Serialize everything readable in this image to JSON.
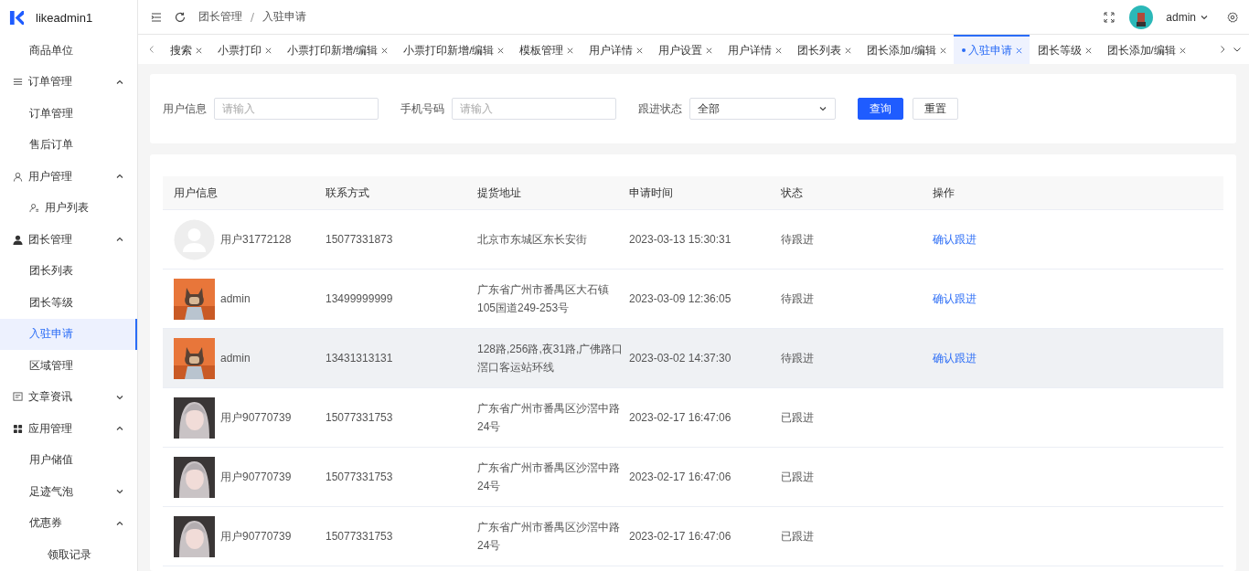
{
  "app": {
    "name": "likeadmin1"
  },
  "sidebar": {
    "items": [
      {
        "label": "商品单位",
        "selected": false
      },
      {
        "label": "订单管理",
        "expanded": true,
        "children": [
          {
            "label": "订单管理",
            "selected": false
          },
          {
            "label": "售后订单",
            "selected": false
          }
        ]
      },
      {
        "label": "用户管理",
        "expanded": true,
        "children": [
          {
            "label": "用户列表",
            "selected": false
          }
        ]
      },
      {
        "label": "团长管理",
        "expanded": true,
        "children": [
          {
            "label": "团长列表",
            "selected": false
          },
          {
            "label": "团长等级",
            "selected": false
          },
          {
            "label": "入驻申请",
            "selected": true
          },
          {
            "label": "区域管理",
            "selected": false
          }
        ]
      },
      {
        "label": "文章资讯",
        "expanded": false
      },
      {
        "label": "应用管理",
        "expanded": true,
        "children": [
          {
            "label": "用户储值",
            "selected": false
          },
          {
            "label": "足迹气泡",
            "expanded": false
          },
          {
            "label": "优惠券",
            "expanded": true,
            "children": [
              {
                "label": "领取记录",
                "selected": false
              }
            ]
          }
        ]
      }
    ]
  },
  "header": {
    "breadcrumb": [
      "团长管理",
      "入驻申请"
    ],
    "user": "admin"
  },
  "tabs": [
    {
      "label": "搜索",
      "selected": false
    },
    {
      "label": "小票打印",
      "selected": false
    },
    {
      "label": "小票打印新增/编辑",
      "selected": false
    },
    {
      "label": "小票打印新增/编辑",
      "selected": false
    },
    {
      "label": "模板管理",
      "selected": false
    },
    {
      "label": "用户详情",
      "selected": false
    },
    {
      "label": "用户设置",
      "selected": false
    },
    {
      "label": "用户详情",
      "selected": false
    },
    {
      "label": "团长列表",
      "selected": false
    },
    {
      "label": "团长添加/编辑",
      "selected": false
    },
    {
      "label": "入驻申请",
      "selected": true
    },
    {
      "label": "团长等级",
      "selected": false
    },
    {
      "label": "团长添加/编辑",
      "selected": false
    }
  ],
  "filters": {
    "fields": [
      {
        "kind": "input",
        "label": "用户信息",
        "placeholder": "请输入"
      },
      {
        "kind": "input",
        "label": "手机号码",
        "placeholder": "请输入"
      },
      {
        "kind": "select",
        "label": "跟进状态",
        "value": "全部"
      }
    ],
    "buttons": [
      {
        "kind": "primary",
        "label": "查询"
      },
      {
        "kind": "default",
        "label": "重置"
      }
    ]
  },
  "table": {
    "columns": [
      "用户信息",
      "联系方式",
      "提货地址",
      "申请时间",
      "状态",
      "操作"
    ],
    "rows": [
      {
        "avatar": {
          "kind": "default"
        },
        "name": "用户31772128",
        "phone": "15077331873",
        "address": "北京市东城区东长安街",
        "time": "2023-03-13 15:30:31",
        "status": "待跟进",
        "action": "确认跟进",
        "selected": false
      },
      {
        "name": "admin",
        "phone": "13499999999",
        "address": "广东省广州市番禺区大石镇105国道249-253号",
        "time": "2023-03-09 12:36:05",
        "status": "待跟进",
        "action": "确认跟进",
        "selected": false
      },
      {
        "name": "admin",
        "phone": "13431313131",
        "address": "128路,256路,夜31路,广佛路口滘口客运站环线",
        "time": "2023-03-02 14:37:30",
        "status": "待跟进",
        "action": "确认跟进",
        "selected": true
      },
      {
        "name": "用户90770739",
        "phone": "15077331753",
        "address": "广东省广州市番禺区沙滘中路24号",
        "time": "2023-02-17 16:47:06",
        "status": "已跟进",
        "selected": false
      },
      {
        "name": "用户90770739",
        "phone": "15077331753",
        "address": "广东省广州市番禺区沙滘中路24号",
        "time": "2023-02-17 16:47:06",
        "status": "已跟进",
        "selected": false
      },
      {
        "name": "用户90770739",
        "phone": "15077331753",
        "address": "广东省广州市番禺区沙滘中路24号",
        "time": "2023-02-17 16:47:06",
        "status": "已跟进",
        "selected": false
      }
    ]
  }
}
